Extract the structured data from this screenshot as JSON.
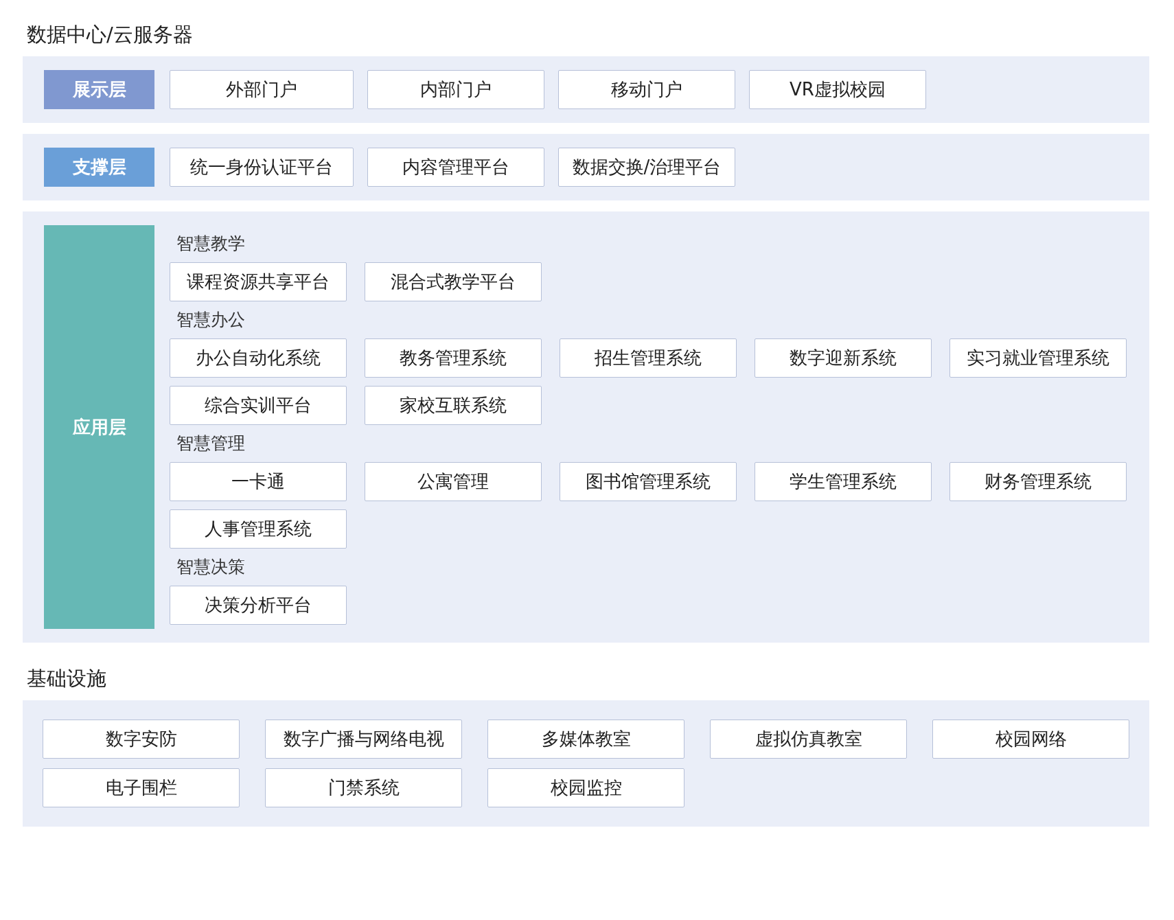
{
  "sections": [
    {
      "title": "数据中心/云服务器",
      "layers": [
        {
          "kind": "flat",
          "label": "展示层",
          "color": "#8098d0",
          "items": [
            "外部门户",
            "内部门户",
            "移动门户",
            "VR虚拟校园"
          ]
        },
        {
          "kind": "flat",
          "label": "支撑层",
          "color": "#6a9fd8",
          "items": [
            "统一身份认证平台",
            "内容管理平台",
            "数据交换/治理平台"
          ]
        },
        {
          "kind": "grouped",
          "label": "应用层",
          "color": "#66b8b5",
          "groups": [
            {
              "title": "智慧教学",
              "items": [
                "课程资源共享平台",
                "混合式教学平台"
              ]
            },
            {
              "title": "智慧办公",
              "items": [
                "办公自动化系统",
                "教务管理系统",
                "招生管理系统",
                "数字迎新系统",
                "实习就业管理系统",
                "综合实训平台",
                "家校互联系统"
              ]
            },
            {
              "title": "智慧管理",
              "items": [
                "一卡通",
                "公寓管理",
                "图书馆管理系统",
                "学生管理系统",
                "财务管理系统",
                "人事管理系统"
              ]
            },
            {
              "title": "智慧决策",
              "items": [
                "决策分析平台"
              ]
            }
          ]
        }
      ]
    },
    {
      "title": "基础设施",
      "items": [
        "数字安防",
        "数字广播与网络电视",
        "多媒体教室",
        "虚拟仿真教室",
        "校园网络",
        "电子围栏",
        "门禁系统",
        "校园监控"
      ]
    }
  ]
}
